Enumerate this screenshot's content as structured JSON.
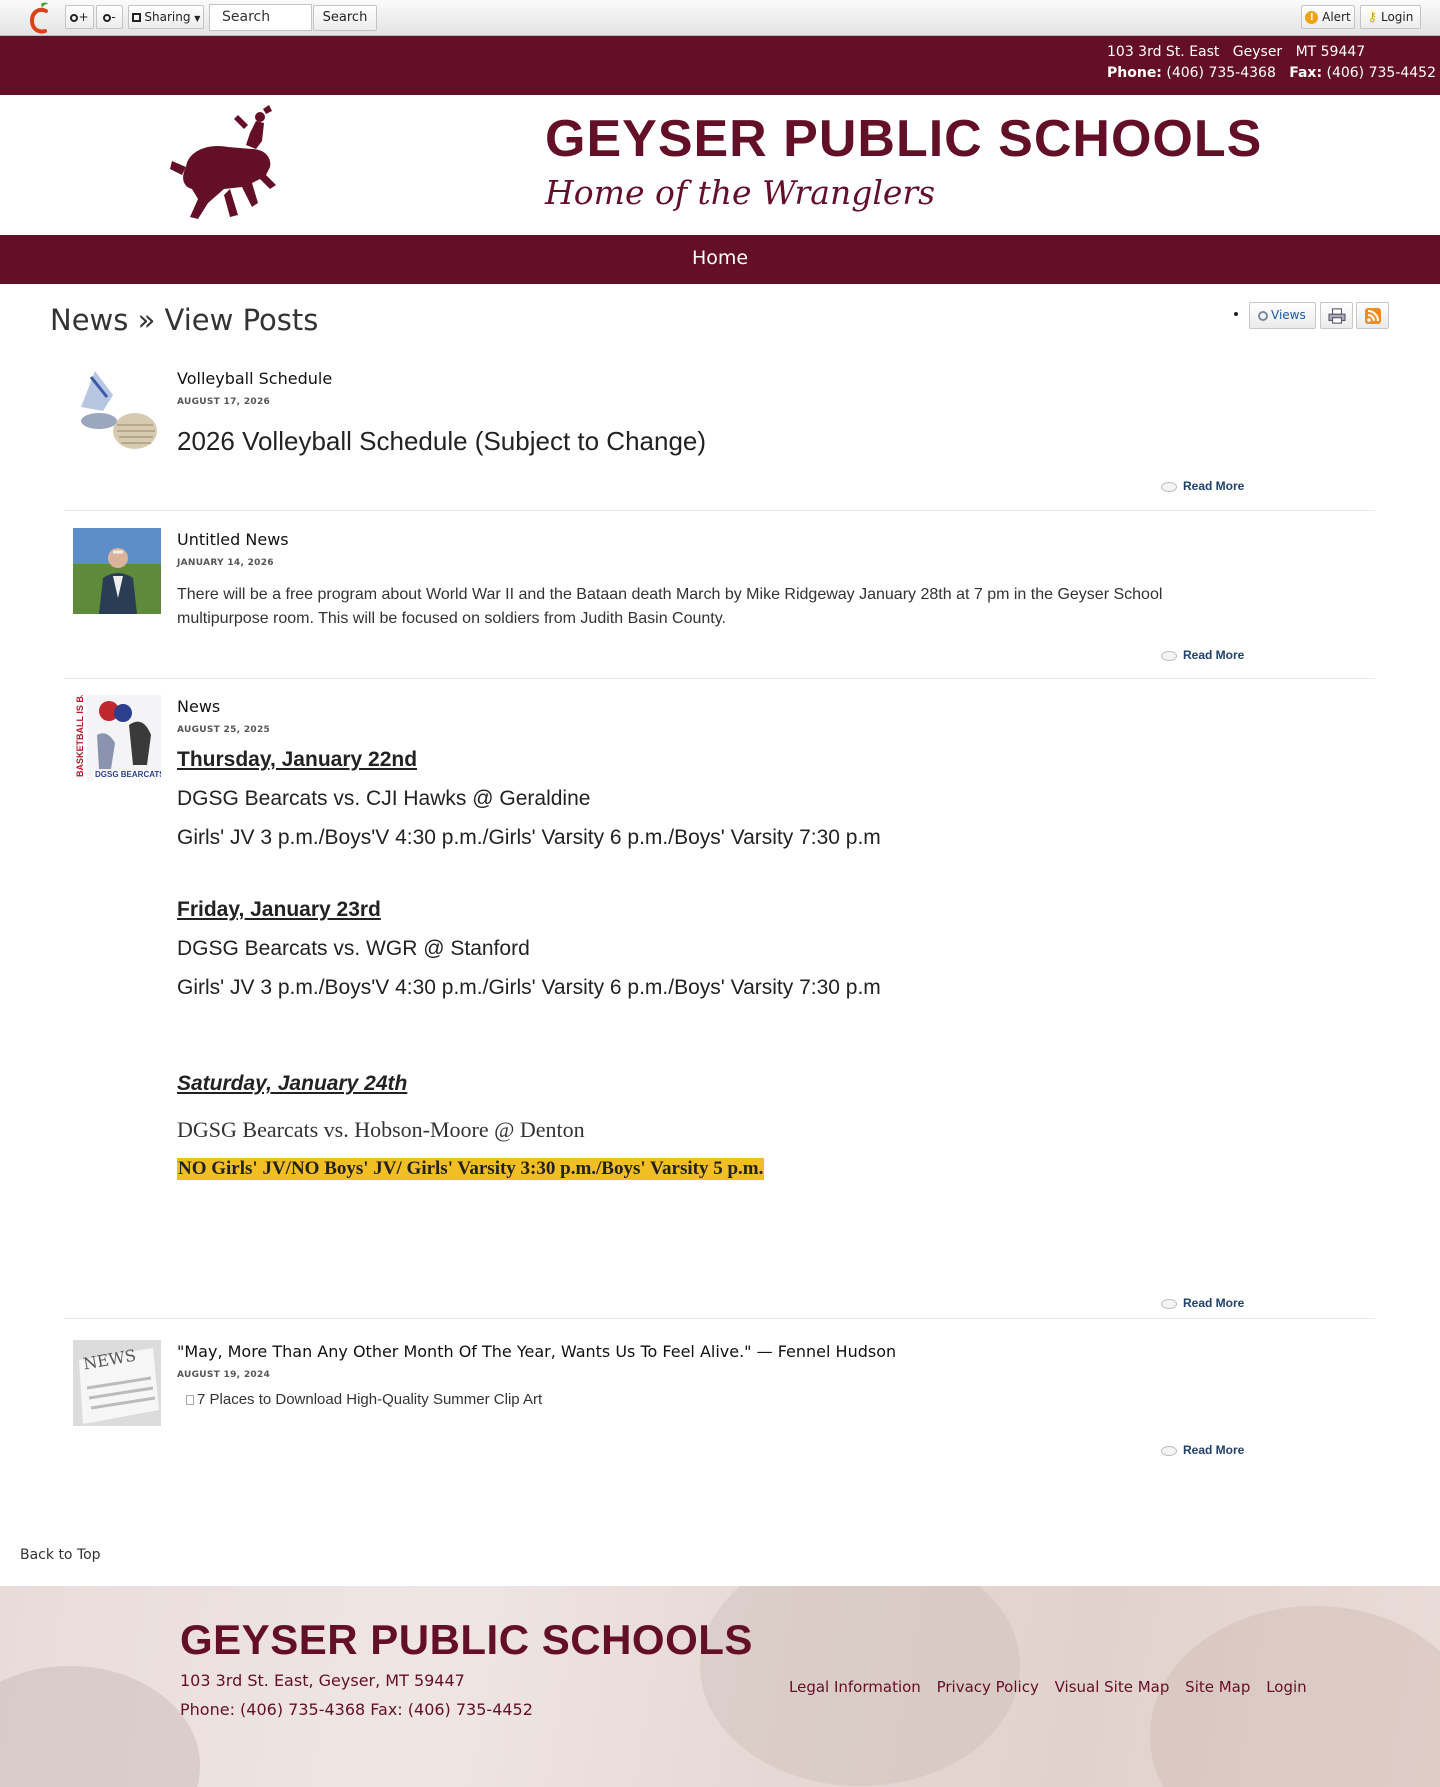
{
  "toolbar": {
    "zoom_in_label": "+",
    "zoom_out_label": "-",
    "sharing_label": "Sharing",
    "search_value": "Search",
    "search_button": "Search",
    "alert_label": "Alert",
    "login_label": "Login"
  },
  "address_bar": {
    "street": "103 3rd St. East",
    "city": "Geyser",
    "state_zip": "MT 59447",
    "phone_label": "Phone:",
    "phone": "(406) 735-4368",
    "fax_label": "Fax:",
    "fax": "(406) 735-4452"
  },
  "header": {
    "school_name": "GEYSER PUBLIC SCHOOLS",
    "tagline": "Home of the Wranglers"
  },
  "nav": {
    "home": "Home"
  },
  "page": {
    "title": "News » View Posts",
    "views_label": "Views"
  },
  "posts": [
    {
      "title": "Volleyball Schedule",
      "date": "AUGUST 17, 2026",
      "body": "2026 Volleyball Schedule (Subject to Change)",
      "read_more": "Read More"
    },
    {
      "title": "Untitled News",
      "date": "JANUARY 14, 2026",
      "body": "There will be a free program about World War II and the Bataan death March by Mike Ridgeway January 28th at 7 pm in the Geyser School multipurpose room. This will be focused on soldiers from Judith Basin County.",
      "read_more": "Read More"
    },
    {
      "title": "News",
      "date": "AUGUST 25, 2025",
      "thumb_text": "BASKETBALL IS BACK",
      "thumb_caption": "DGSG BEARCATS",
      "day1_heading": "Thursday, January 22nd",
      "day1_game": "DGSG Bearcats vs. CJI Hawks @ Geraldine",
      "day1_times": "Girls' JV 3 p.m./Boys'V 4:30 p.m./Girls' Varsity 6 p.m./Boys' Varsity 7:30 p.m",
      "day2_heading": "Friday, January 23rd",
      "day2_game": "DGSG Bearcats vs. WGR @ Stanford",
      "day2_times": "Girls' JV 3 p.m./Boys'V 4:30 p.m./Girls' Varsity 6 p.m./Boys' Varsity 7:30 p.m",
      "day3_heading": "Saturday, January 24th",
      "day3_game": "DGSG Bearcats vs. Hobson-Moore @ Denton",
      "day3_times": "NO Girls' JV/NO Boys' JV/ Girls' Varsity 3:30 p.m./Boys' Varsity 5 p.m.",
      "read_more": "Read More"
    },
    {
      "title": "\"May, More Than Any Other Month Of The Year, Wants Us To Feel Alive.\" — Fennel Hudson",
      "date": "AUGUST 19, 2024",
      "thumb_text": "NEWS",
      "image_alt": "7 Places to Download High-Quality Summer Clip Art",
      "read_more": "Read More"
    }
  ],
  "back_to_top": "Back to Top",
  "footer": {
    "school_name": "GEYSER PUBLIC SCHOOLS",
    "address": "103 3rd St. East, Geyser, MT 59447",
    "phone": "Phone: (406) 735-4368",
    "fax": "Fax: (406) 735-4452",
    "links": [
      "Legal Information",
      "Privacy Policy",
      "Visual Site Map",
      "Site Map",
      "Login"
    ]
  },
  "colors": {
    "brand": "#640f28",
    "highlight": "#f1be23",
    "link": "#1f3f6e"
  },
  "icons": [
    "apple-logo-icon",
    "zoom-in-icon",
    "zoom-out-icon",
    "share-icon",
    "alert-icon",
    "key-icon",
    "views-icon",
    "print-icon",
    "rss-icon",
    "comment-bubble-icon"
  ]
}
